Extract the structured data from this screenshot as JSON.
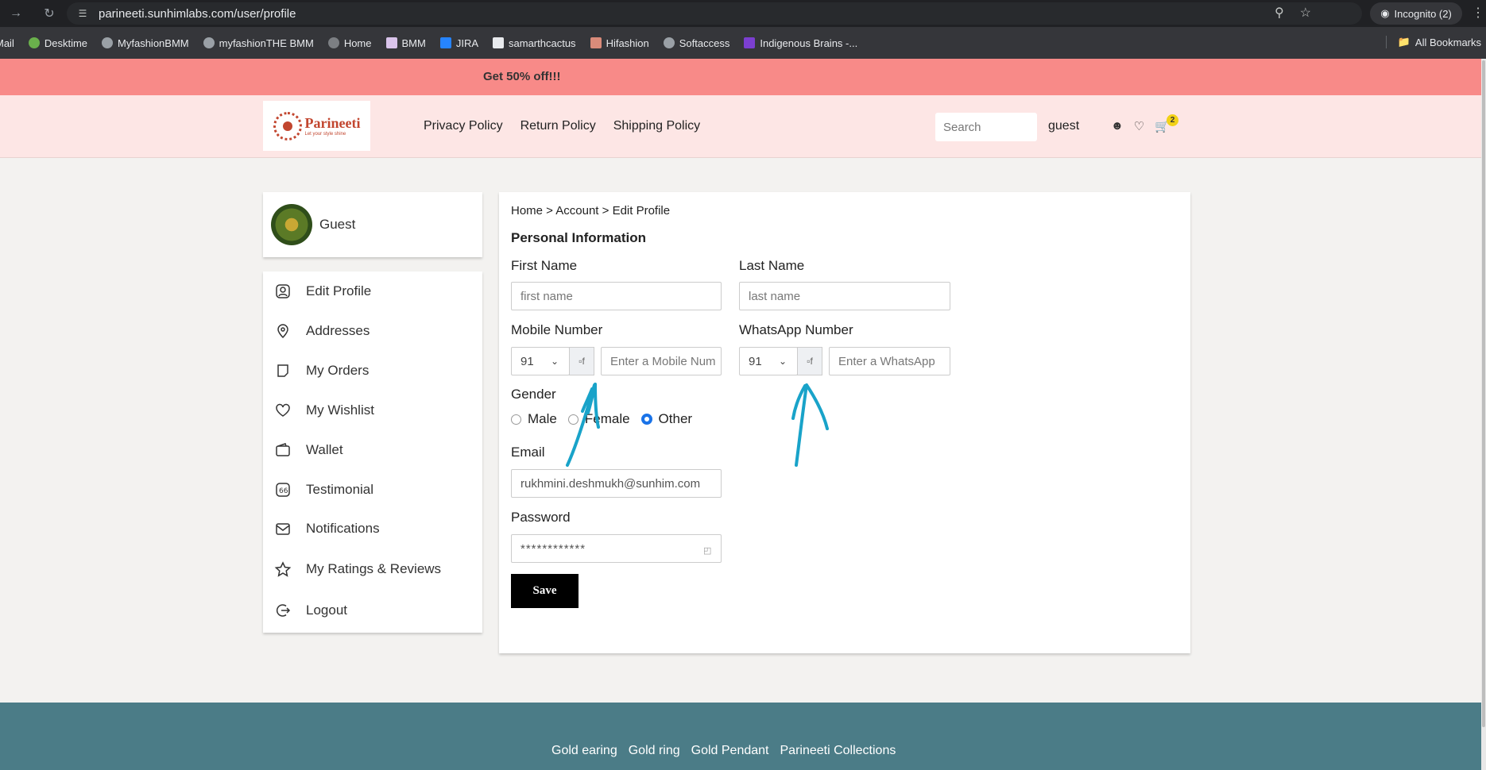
{
  "browser": {
    "url": "parineeti.sunhimlabs.com/user/profile",
    "incognito_label": "Incognito (2)",
    "bookmarks": [
      "Mail",
      "Desktime",
      "MyfashionBMM",
      "myfashionTHE BMM",
      "Home",
      "BMM",
      "JIRA",
      "samarthcactus",
      "Hifashion",
      "Softaccess",
      "Indigenous Brains -..."
    ],
    "all_bookmarks": "All Bookmarks",
    "icons": {
      "forward": "arrow-right-icon",
      "reload": "reload-icon",
      "site": "tune-icon",
      "zoom": "zoom-icon",
      "star": "star-icon",
      "kebab": "kebab-icon"
    }
  },
  "promo": {
    "text": "Get 50% off!!!",
    "color": "#f88a88"
  },
  "header": {
    "logo_name": "Parineeti",
    "logo_tagline": "Let your style shine",
    "menu": [
      "Privacy Policy",
      "Return Policy",
      "Shipping Policy"
    ],
    "search_placeholder": "Search",
    "user_label": "guest",
    "cart_count": "2"
  },
  "sidebar": {
    "profile_name": "Guest",
    "items": [
      {
        "label": "Edit Profile",
        "icon": "user-icon"
      },
      {
        "label": "Addresses",
        "icon": "location-pin-icon"
      },
      {
        "label": "My Orders",
        "icon": "orders-icon"
      },
      {
        "label": "My Wishlist",
        "icon": "heart-icon"
      },
      {
        "label": "Wallet",
        "icon": "wallet-icon"
      },
      {
        "label": "Testimonial",
        "icon": "quote-icon"
      },
      {
        "label": "Notifications",
        "icon": "mail-icon"
      },
      {
        "label": "My Ratings & Reviews",
        "icon": "star-rating-icon"
      },
      {
        "label": "Logout",
        "icon": "logout-icon"
      }
    ]
  },
  "main": {
    "breadcrumb": "Home > Account > Edit Profile",
    "section_title": "Personal Information",
    "first_name": {
      "label": "First Name",
      "placeholder": "first name"
    },
    "last_name": {
      "label": "Last Name",
      "placeholder": "last name"
    },
    "mobile": {
      "label": "Mobile Number",
      "code": "91",
      "flag_alt": "f",
      "placeholder": "Enter a Mobile Num"
    },
    "whatsapp": {
      "label": "WhatsApp Number",
      "code": "91",
      "flag_alt": "f",
      "placeholder": "Enter a WhatsApp"
    },
    "gender": {
      "label": "Gender",
      "options": [
        "Male",
        "Female",
        "Other"
      ],
      "selected": "Other"
    },
    "email": {
      "label": "Email",
      "value": "rukhmini.deshmukh@sunhim.com"
    },
    "password": {
      "label": "Password",
      "value": "************"
    },
    "save_label": "Save"
  },
  "footer": {
    "links": [
      "Gold earing",
      "Gold ring",
      "Gold Pendant",
      "Parineeti Collections"
    ],
    "color": "#4b7c87"
  }
}
